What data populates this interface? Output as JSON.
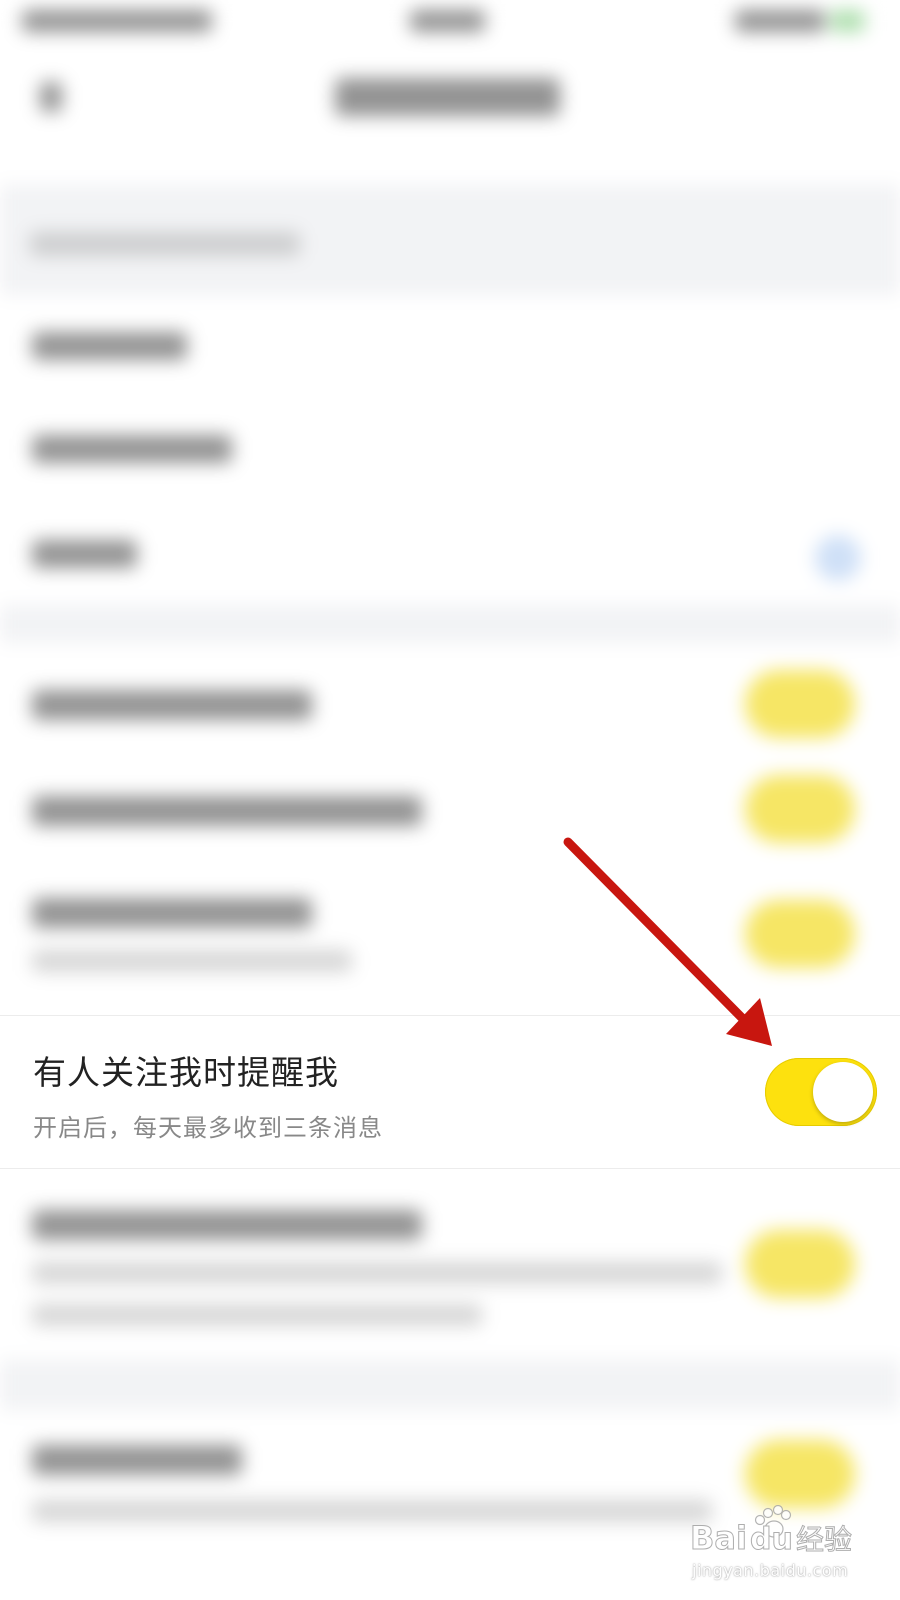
{
  "setting": {
    "title": "有人关注我时提醒我",
    "subtitle": "开启后，每天最多收到三条消息",
    "toggle_state": "on",
    "toggle_color": "#fde10e"
  },
  "annotation": {
    "arrow_color": "#c8160f"
  },
  "watermark": {
    "logo_text": "Bai经验",
    "url": "jingyan.baidu.com"
  }
}
